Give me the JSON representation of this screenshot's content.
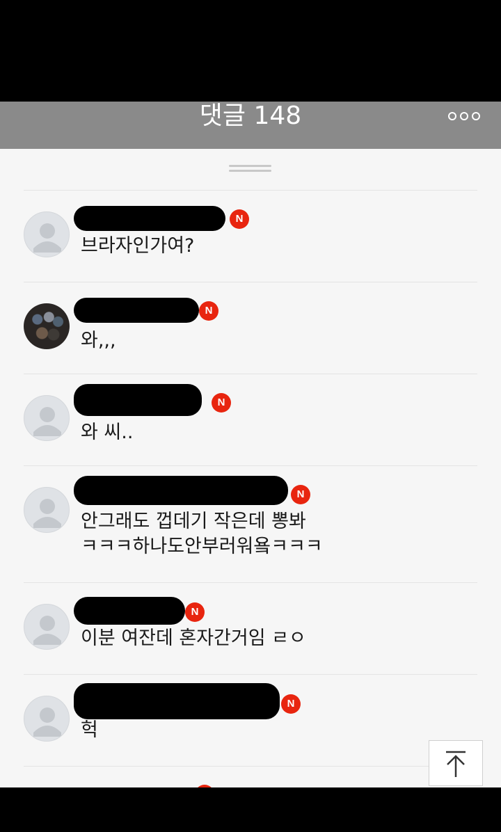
{
  "header": {
    "title": "댓글 148",
    "more_icon": "more-horizontal-icon"
  },
  "comments": [
    {
      "badge": "N",
      "text": "브라자인가여?",
      "avatar": "default-avatar"
    },
    {
      "badge": "N",
      "text": "와,,,",
      "avatar": "photo-avatar"
    },
    {
      "badge": "N",
      "text": "와 씨..",
      "avatar": "default-avatar"
    },
    {
      "badge": "N",
      "text": "안그래도 껍데기 작은데 뽕봐\nㅋㅋㅋ하나도안부러워욬ㅋㅋㅋ",
      "avatar": "default-avatar"
    },
    {
      "badge": "N",
      "text": "이분 여잔데 혼자간거임 ㄹㅇ",
      "avatar": "default-avatar"
    },
    {
      "badge": "N",
      "text": "헉",
      "avatar": "default-avatar"
    }
  ],
  "scroll_top_icon": "arrow-up-to-top-icon",
  "colors": {
    "header_bg": "#8a8a8a",
    "badge": "#e8250f",
    "panel_bg": "#f6f6f6"
  }
}
